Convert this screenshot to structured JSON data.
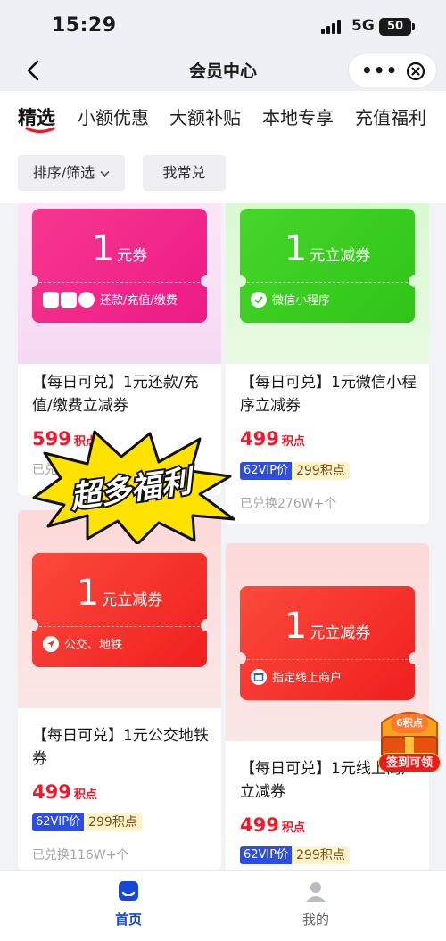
{
  "status_bar": {
    "time": "15:29",
    "network": "5G",
    "battery": "50"
  },
  "nav": {
    "title": "会员中心",
    "more_label": "•••"
  },
  "tabs": [
    {
      "label": "精选",
      "active": true
    },
    {
      "label": "小额优惠",
      "active": false
    },
    {
      "label": "大额补贴",
      "active": false
    },
    {
      "label": "本地专享",
      "active": false
    },
    {
      "label": "充值福利",
      "active": false
    }
  ],
  "filters": {
    "sort_label": "排序/筛选",
    "frequent_label": "我常兑"
  },
  "cards": [
    {
      "amount": "1",
      "coupon_text": "元券",
      "subtitle": "还款/充值/缴费",
      "title": "【每日可兑】1元还款/充值/缴费立减券",
      "price": "599",
      "price_unit": "积点",
      "sold": "已兑"
    },
    {
      "amount": "1",
      "coupon_text": "元立减券",
      "subtitle": "微信小程序",
      "title": "【每日可兑】1元微信小程序立减券",
      "price": "499",
      "price_unit": "积点",
      "vip_label": "62VIP价",
      "vip_price": "299积点",
      "sold": "已兑换276W+个"
    },
    {
      "amount": "1",
      "coupon_text": "元立减券",
      "subtitle": "公交、地铁",
      "title": "【每日可兑】1元公交地铁券",
      "price": "499",
      "price_unit": "积点",
      "vip_label": "62VIP价",
      "vip_price": "299积点",
      "sold": "已兑换116W+个"
    },
    {
      "amount": "1",
      "coupon_text": "元立减券",
      "subtitle": "指定线上商户",
      "title": "【每日可兑】1元线上商户立减券",
      "price": "499",
      "price_unit": "积点",
      "vip_label": "62VIP价",
      "vip_price": "299积点"
    }
  ],
  "promo_burst": {
    "text": "超多福利"
  },
  "gift_badge": {
    "points": "6积点",
    "label": "签到可领"
  },
  "bottom_nav": [
    {
      "label": "首页",
      "active": true,
      "icon": "home-icon"
    },
    {
      "label": "我的",
      "active": false,
      "icon": "profile-icon"
    }
  ],
  "colors": {
    "accent_red": "#f0182b",
    "ticket_pink": "#f0208c",
    "ticket_green": "#3ccf1f",
    "ticket_red": "#f4322e",
    "vip_blue": "#2c4ee6",
    "nav_active": "#1747d8"
  }
}
